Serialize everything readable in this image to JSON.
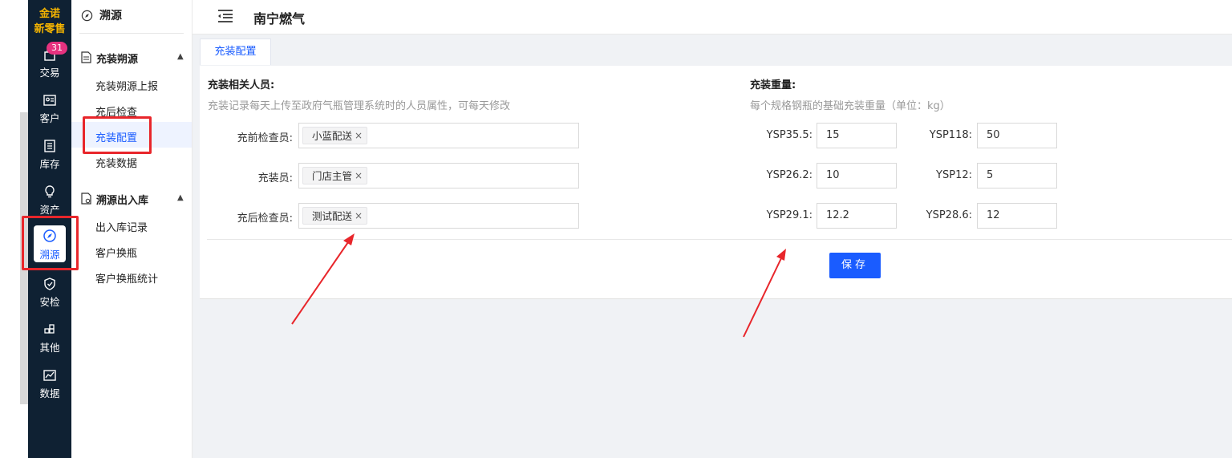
{
  "brand": {
    "logo_line1": "金诺",
    "logo_line2": "新零售"
  },
  "rail": {
    "badge": "31",
    "items": [
      {
        "label": "交易",
        "icon": "bag-icon"
      },
      {
        "label": "客户",
        "icon": "id-card-icon"
      },
      {
        "label": "库存",
        "icon": "list-icon"
      },
      {
        "label": "资产",
        "icon": "lightbulb-icon"
      },
      {
        "label": "溯源",
        "icon": "compass-icon"
      },
      {
        "label": "安检",
        "icon": "shield-icon"
      },
      {
        "label": "其他",
        "icon": "apps-icon"
      },
      {
        "label": "数据",
        "icon": "chart-icon"
      }
    ]
  },
  "submenu": {
    "title": "溯源",
    "groups": [
      {
        "label": "充装朔源",
        "items": [
          "充装朔源上报",
          "充后检查",
          "充装配置",
          "充装数据"
        ]
      },
      {
        "label": "溯源出入库",
        "items": [
          "出入库记录",
          "客户换瓶",
          "客户换瓶统计"
        ]
      }
    ]
  },
  "topbar": {
    "title": "南宁燃气"
  },
  "tabs": [
    "充装配置"
  ],
  "personnel": {
    "title": "充装相关人员:",
    "description": "充装记录每天上传至政府气瓶管理系统时的人员属性，可每天修改",
    "fields": [
      {
        "label": "充前检查员:",
        "tag": "小蓝配送"
      },
      {
        "label": "充装员:",
        "tag": "门店主管"
      },
      {
        "label": "充后检查员:",
        "tag": "测试配送"
      }
    ]
  },
  "weights": {
    "title": "充装重量:",
    "description": "每个规格钢瓶的基础充装重量（单位：kg）",
    "rows": [
      {
        "left_label": "YSP35.5:",
        "left_value": "15",
        "right_label": "YSP118:",
        "right_value": "50"
      },
      {
        "left_label": "YSP26.2:",
        "left_value": "10",
        "right_label": "YSP12:",
        "right_value": "5"
      },
      {
        "left_label": "YSP29.1:",
        "left_value": "12.2",
        "right_label": "YSP28.6:",
        "right_value": "12"
      }
    ]
  },
  "actions": {
    "save": "保存"
  },
  "colors": {
    "primary": "#1a5cff",
    "rail_bg": "#0f2133",
    "badge": "#e6327f",
    "annotation": "#e8262b"
  }
}
